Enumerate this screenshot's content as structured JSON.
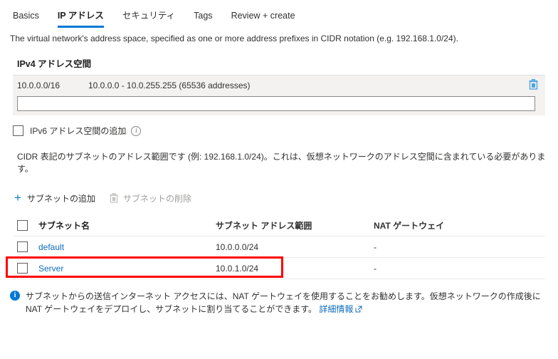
{
  "tabs": [
    {
      "label": "Basics",
      "active": false
    },
    {
      "label": "IP アドレス",
      "active": true
    },
    {
      "label": "セキュリティ",
      "active": false
    },
    {
      "label": "Tags",
      "active": false
    },
    {
      "label": "Review + create",
      "active": false
    }
  ],
  "description": "The virtual network's address space, specified as one or more address prefixes in CIDR notation (e.g. 192.168.1.0/24).",
  "address_space": {
    "title": "IPv4 アドレス空間",
    "rows": [
      {
        "prefix": "10.0.0.0/16",
        "range": "10.0.0.0 - 10.0.255.255 (65536 addresses)",
        "delete_icon": "trash-icon"
      }
    ],
    "new_entry_value": "",
    "new_entry_placeholder": ""
  },
  "ipv6": {
    "label": "IPv6 アドレス空間の追加",
    "checked": false,
    "info_icon": "info-icon"
  },
  "cidr_note": "CIDR 表記のサブネットのアドレス範囲です (例: 192.168.1.0/24)。これは、仮想ネットワークのアドレス空間に含まれている必要があります。",
  "subnet_toolbar": {
    "add_label": "サブネットの追加",
    "add_icon": "plus-icon",
    "delete_label": "サブネットの削除",
    "delete_icon": "trash-icon",
    "delete_disabled": true
  },
  "subnet_table": {
    "columns": [
      "サブネット名",
      "サブネット アドレス範囲",
      "NAT ゲートウェイ"
    ],
    "rows": [
      {
        "name": "default",
        "range": "10.0.0.0/24",
        "nat": "-",
        "checked": false,
        "highlighted": false
      },
      {
        "name": "Server",
        "range": "10.0.1.0/24",
        "nat": "-",
        "checked": false,
        "highlighted": true
      }
    ]
  },
  "info_banner": {
    "icon": "info-icon",
    "text": "サブネットからの送信インターネット アクセスには、NAT ゲートウェイを使用することをお勧めします。仮想ネットワークの作成後に NAT ゲートウェイをデプロイし、サブネットに割り当てることができます。",
    "link_label": "詳細情報",
    "link_icon": "external-link-icon"
  },
  "colors": {
    "accent": "#0078d4",
    "link": "#0f6cbd",
    "annotation": "#ff0000",
    "panel_bg": "#f3f2f1",
    "disabled_text": "#a19f9d"
  }
}
